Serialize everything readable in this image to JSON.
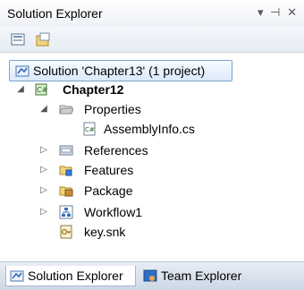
{
  "window": {
    "title": "Solution Explorer",
    "controls": "▾ ⊣ ✕"
  },
  "toolbar": {
    "buttons": [
      {
        "icon": "properties-icon"
      },
      {
        "icon": "show-all-files-icon"
      }
    ]
  },
  "tree": {
    "solution": "Solution 'Chapter13' (1 project)",
    "project": "Chapter12",
    "items": [
      {
        "label": "Properties",
        "icon": "folder-open-icon"
      },
      {
        "label": "AssemblyInfo.cs",
        "icon": "csharp-file-icon"
      },
      {
        "label": "References",
        "icon": "references-icon"
      },
      {
        "label": "Features",
        "icon": "features-icon"
      },
      {
        "label": "Package",
        "icon": "package-icon"
      },
      {
        "label": "Workflow1",
        "icon": "workflow-icon"
      },
      {
        "label": "key.snk",
        "icon": "key-file-icon"
      }
    ]
  },
  "tabs": [
    {
      "label": "Solution Explorer",
      "icon": "solution-explorer-icon"
    },
    {
      "label": "Team Explorer",
      "icon": "team-explorer-icon"
    }
  ],
  "colors": {
    "selection_border": "#7da2ce",
    "selection_fill": "#dbe9fb",
    "tab_bar": "#cdd7e6"
  }
}
